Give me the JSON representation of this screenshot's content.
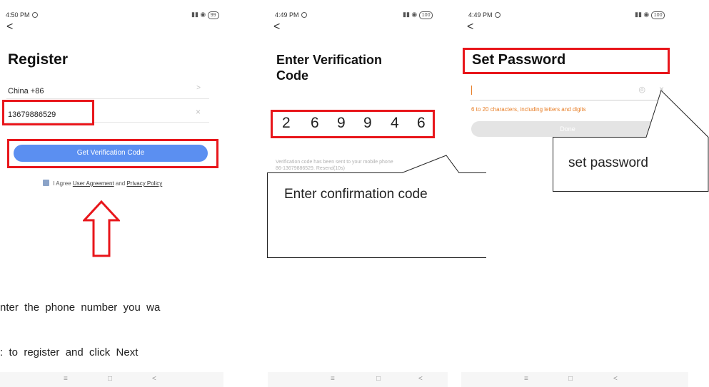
{
  "screen1": {
    "time": "4:50 PM",
    "battery": "99",
    "title": "Register",
    "country": "China +86",
    "country_chevron": ">",
    "phone": "13679886529",
    "clear_icon": "×",
    "button": "Get Verification Code",
    "agree_prefix": "I Agree",
    "user_agreement": "User Agreement",
    "agree_and": "and",
    "privacy_policy": "Privacy Policy",
    "instruction_line1": "nter  the  phone  number  you  wa",
    "instruction_line2": ":  to  register  and  click  Next"
  },
  "screen2": {
    "time": "4:49 PM",
    "battery": "100",
    "title_line1": "Enter Verification",
    "title_line2": "Code",
    "digits": [
      "2",
      "6",
      "9",
      "9",
      "4",
      "6"
    ],
    "sent_line1": "Verification code has been sent to your mobile phone",
    "sent_line2": "86-13679886529. Resend(10s)",
    "callout": "Enter confirmation code"
  },
  "screen3": {
    "time": "4:49 PM",
    "battery": "100",
    "title": "Set Password",
    "hint": "6 to 20 characters, including letters and digits",
    "done": "Done",
    "callout": "set password"
  },
  "nav_icons": [
    "≡",
    "□",
    "<"
  ],
  "colors": {
    "highlight": "#e8161b",
    "button_blue": "#5b8ff1",
    "hint_orange": "#e8802a",
    "done_grey": "#e4e4e4"
  }
}
